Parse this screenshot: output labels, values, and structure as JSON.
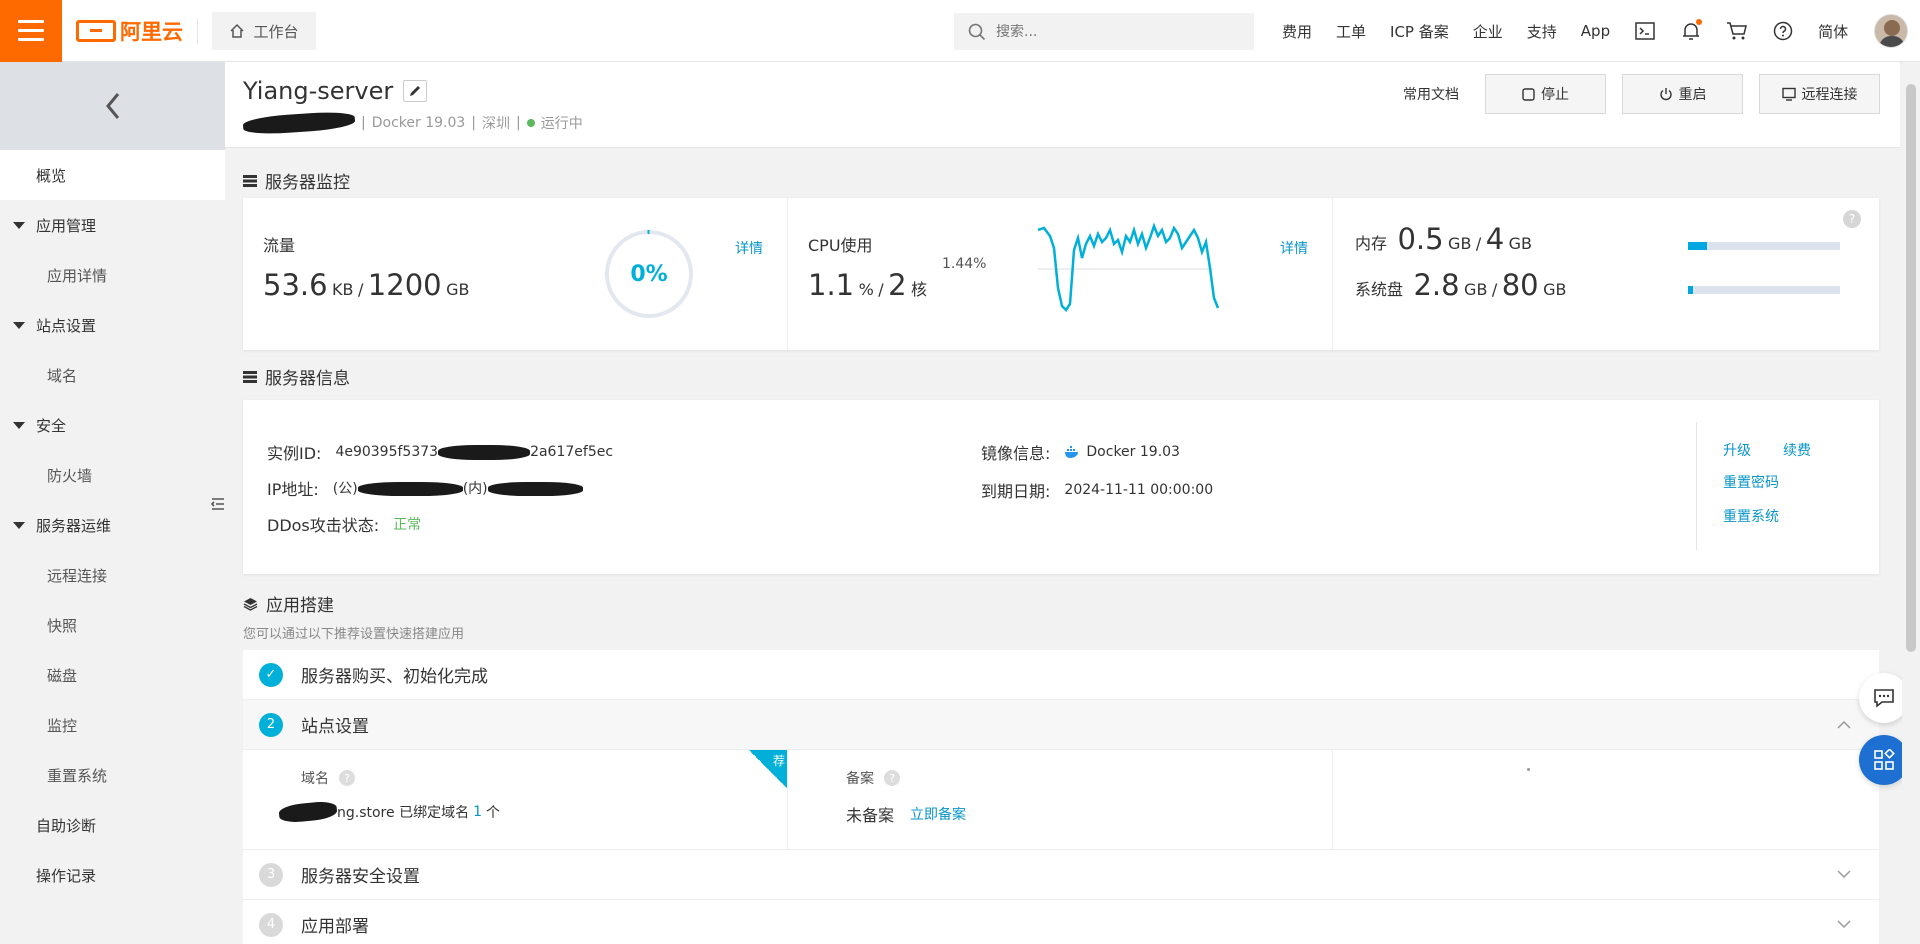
{
  "topbar": {
    "logo_text": "阿里云",
    "workbench_label": "工作台",
    "search_placeholder": "搜索...",
    "nav": [
      "费用",
      "工单",
      "ICP 备案",
      "企业",
      "支持",
      "App"
    ],
    "icons": [
      "terminal-icon",
      "bell-icon",
      "cart-icon",
      "help-icon"
    ],
    "lang": "简体"
  },
  "sidebar": {
    "items": [
      {
        "label": "概览",
        "level": 1,
        "active": true
      },
      {
        "label": "应用管理",
        "level": 0
      },
      {
        "label": "应用详情",
        "level": 2
      },
      {
        "label": "站点设置",
        "level": 0
      },
      {
        "label": "域名",
        "level": 2
      },
      {
        "label": "安全",
        "level": 0
      },
      {
        "label": "防火墙",
        "level": 2
      },
      {
        "label": "服务器运维",
        "level": 0
      },
      {
        "label": "远程连接",
        "level": 2
      },
      {
        "label": "快照",
        "level": 2
      },
      {
        "label": "磁盘",
        "level": 2
      },
      {
        "label": "监控",
        "level": 2
      },
      {
        "label": "重置系统",
        "level": 2
      },
      {
        "label": "自助诊断",
        "level": 1
      },
      {
        "label": "操作记录",
        "level": 1
      }
    ]
  },
  "header": {
    "server_name": "Yiang-server",
    "docker": "Docker 19.03",
    "region": "深圳",
    "status": "运行中",
    "separator": "|",
    "docs_link": "常用文档",
    "stop": "停止",
    "restart": "重启",
    "remote": "远程连接"
  },
  "monitor": {
    "title": "服务器监控",
    "traffic": {
      "label": "流量",
      "used": "53.6",
      "used_unit": "KB",
      "slash": "/",
      "total": "1200",
      "total_unit": "GB",
      "percent_text": "0%",
      "percent": 0,
      "detail": "详情"
    },
    "cpu": {
      "label": "CPU使用",
      "value": "1.1",
      "value_unit": "%",
      "slash": "/",
      "cores": "2",
      "cores_unit": "核",
      "ref_label": "1.44%",
      "detail": "详情"
    },
    "memory": {
      "label": "内存",
      "used": "0.5",
      "used_unit": "GB",
      "slash": "/",
      "total": "4",
      "total_unit": "GB",
      "fraction": 0.125
    },
    "disk": {
      "label": "系统盘",
      "used": "2.8",
      "used_unit": "GB",
      "slash": "/",
      "total": "80",
      "total_unit": "GB",
      "fraction": 0.035
    }
  },
  "info": {
    "title": "服务器信息",
    "instance_label": "实例ID:",
    "instance_id_start": "4e90395f5373",
    "instance_id_end": "2a617ef5ec",
    "ip_label": "IP地址:",
    "ip_public": "(公)",
    "ip_private": "(内)",
    "ddos_label": "DDos攻击状态:",
    "ddos_value": "正常",
    "image_label": "镜像信息:",
    "image_value": "Docker 19.03",
    "expire_label": "到期日期:",
    "expire_value": "2024-11-11 00:00:00",
    "actions": {
      "upgrade": "升级",
      "renew": "续费",
      "reset_password": "重置密码",
      "reset_system": "重置系统"
    }
  },
  "app": {
    "title": "应用搭建",
    "subtitle": "您可以通过以下推荐设置快速搭建应用",
    "steps": [
      {
        "num": "✓",
        "label": "服务器购买、初始化完成"
      },
      {
        "num": "2",
        "label": "站点设置"
      },
      {
        "num": "3",
        "label": "服务器安全设置"
      },
      {
        "num": "4",
        "label": "应用部署"
      }
    ],
    "domain_label": "域名",
    "domain_text": "ng.store 已绑定域名",
    "domain_count": "1",
    "domain_unit": "个",
    "recommend_badge": "荐",
    "beian_label": "备案",
    "beian_status": "未备案",
    "beian_link": "立即备案"
  },
  "colors": {
    "brand": "#ff6a00",
    "link": "#0a95c8",
    "teal": "#00b0d8",
    "green": "#5cb85c"
  }
}
